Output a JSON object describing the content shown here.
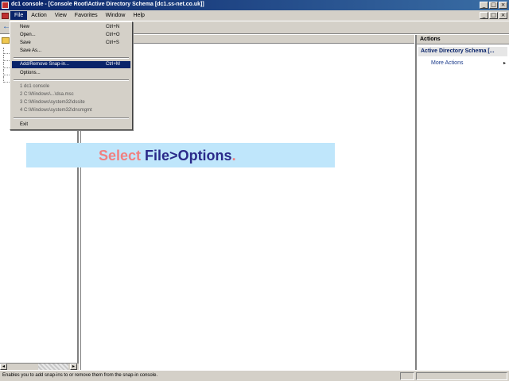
{
  "window": {
    "title": "dc1 console - [Console Root\\Active Directory Schema [dc1.ss-net.co.uk]]",
    "controls": [
      "_",
      "□",
      "×"
    ]
  },
  "menubar": {
    "items": [
      "File",
      "Action",
      "View",
      "Favorites",
      "Window",
      "Help"
    ],
    "active": "File",
    "controls": [
      "_",
      "□",
      "×"
    ]
  },
  "file_menu": {
    "items": [
      {
        "label": "New",
        "shortcut": "Ctrl+N"
      },
      {
        "label": "Open...",
        "shortcut": "Ctrl+O"
      },
      {
        "label": "Save",
        "shortcut": "Ctrl+S"
      },
      {
        "label": "Save As..."
      },
      {
        "label": "Add/Remove Snap-in...",
        "shortcut": "Ctrl+M"
      },
      {
        "label": "Options..."
      },
      {
        "label": "1 dc1 console"
      },
      {
        "label": "2 C:\\Windows\\...\\dsa.msc"
      },
      {
        "label": "3 C:\\Windows\\system32\\dssite"
      },
      {
        "label": "4 C:\\Windows\\system32\\dnsmgmt"
      },
      {
        "label": "Exit"
      }
    ]
  },
  "actions_pane": {
    "header": "Actions",
    "section": "Active Directory Schema [...",
    "items": [
      "More Actions"
    ],
    "arrow": "▸"
  },
  "status_bar": {
    "text": "Enables you to add snap-ins to or remove them from the snap-in console."
  },
  "callout": {
    "word1": "Select ",
    "word2": "File>Options",
    "word3": "."
  },
  "icons": {
    "back": "←",
    "left_arrow": "◂",
    "right_arrow": "▸"
  }
}
